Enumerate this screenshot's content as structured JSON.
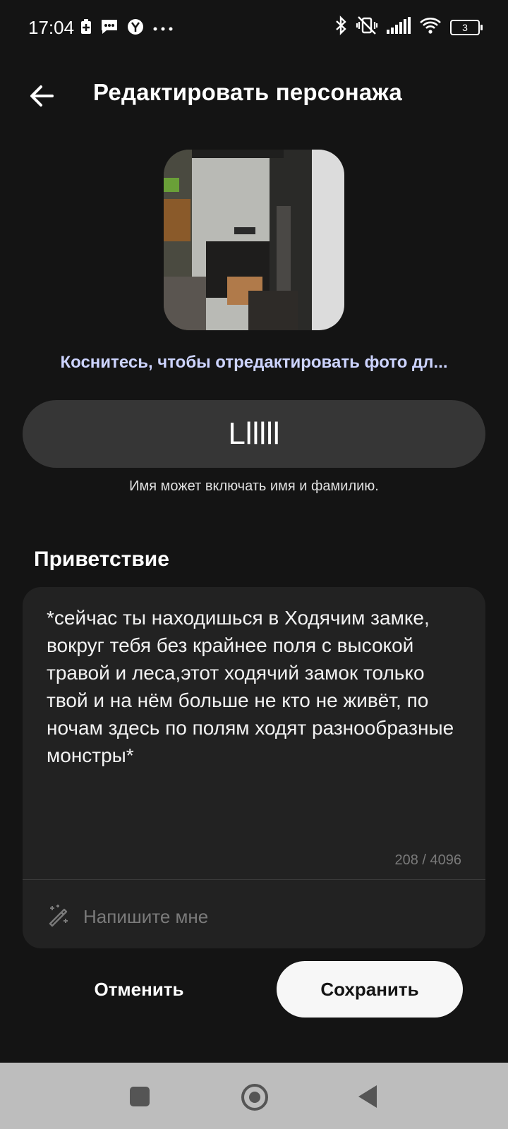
{
  "status_bar": {
    "time": "17:04",
    "left_icons": [
      "battery-saver-icon",
      "message-icon",
      "yandex-icon",
      "more-dots-icon"
    ],
    "right_icons": [
      "bluetooth-icon",
      "vibrate-off-icon",
      "signal-icon",
      "wifi-icon",
      "battery-icon"
    ],
    "battery_level": "3"
  },
  "header": {
    "title": "Редактировать персонажа",
    "back_icon": "arrow-left-icon"
  },
  "avatar": {
    "edit_photo_text": "Коснитесь, чтобы отредактировать фото дл..."
  },
  "name_field": {
    "value": "Llllll",
    "hint": "Имя может включать имя и фамилию."
  },
  "greeting": {
    "label": "Приветствие",
    "text": "*сейчас ты находишься в Ходячим замке, вокруг тебя без крайнее поля с высокой травой и леса,этот ходячий замок только твой и на нём больше не кто не живёт, по ночам здесь по полям ходят разнообразные монстры*",
    "counter": "208 / 4096",
    "write_me_label": "Напишите мне",
    "write_me_icon": "magic-wand-icon"
  },
  "actions": {
    "cancel_label": "Отменить",
    "save_label": "Сохранить"
  },
  "nav_bar": {
    "icons": [
      "recents-square-icon",
      "home-circle-icon",
      "back-triangle-icon"
    ]
  },
  "colors": {
    "background": "#141414",
    "field": "#363636",
    "card": "#222222",
    "link": "#cdd4ff",
    "save_button": "#f7f7f7"
  }
}
